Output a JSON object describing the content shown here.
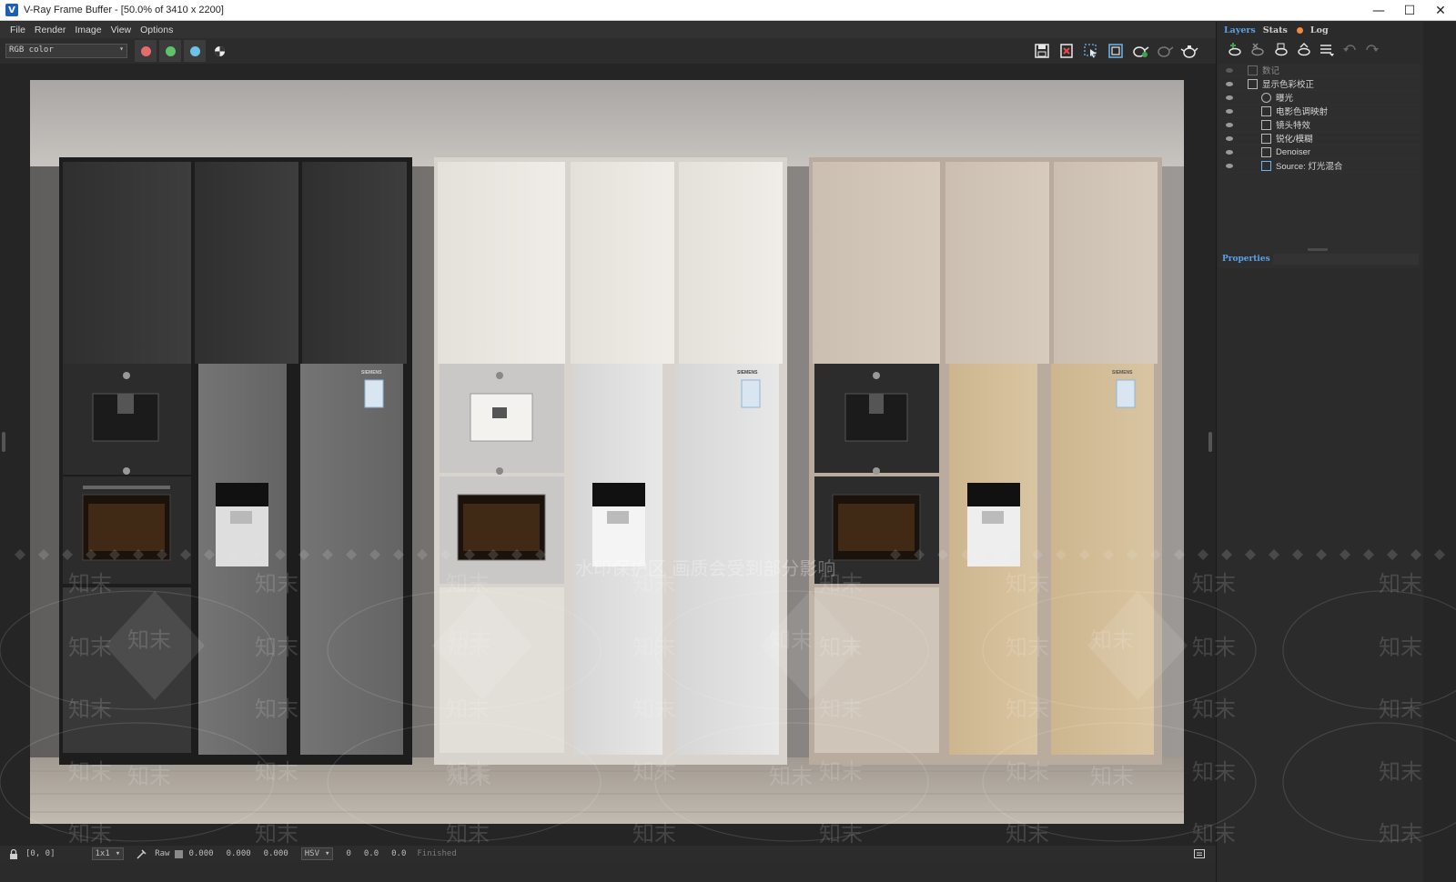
{
  "window": {
    "title": "V-Ray Frame Buffer - [50.0% of 3410 x 2200]",
    "app_icon": "V",
    "controls": {
      "minimize": "—",
      "maximize": "☐",
      "close": "✕"
    }
  },
  "menu": [
    "File",
    "Render",
    "Image",
    "View",
    "Options"
  ],
  "toolbar": {
    "channel": "RGB color",
    "channel_arrow": "▾",
    "color_buttons": [
      {
        "name": "red-channel",
        "color": "#e46c6c"
      },
      {
        "name": "green-channel",
        "color": "#5ec46a"
      },
      {
        "name": "blue-channel",
        "color": "#6cc3e8"
      }
    ],
    "right_icons": [
      "save-image-icon",
      "clear-image-icon",
      "region-render-icon",
      "track-mouse-icon",
      "render-icon",
      "stop-render-icon",
      "render-teapot-icon"
    ]
  },
  "render": {
    "product_brand": "SIEMENS",
    "watermark_banner": "水印保护区  画质会受到部分影响",
    "watermark_tile": "知末"
  },
  "status": {
    "coords": "[0, 0]",
    "zoom": "1x1",
    "zoom_arrow": "▾",
    "mode": "Raw",
    "values": [
      "0.000",
      "0.000",
      "0.000"
    ],
    "color_mode": "HSV",
    "hsv_values": [
      "0",
      "0.0",
      "0.0"
    ],
    "state": "Finished"
  },
  "panel": {
    "tabs": [
      "Layers",
      "Stats",
      "Log"
    ],
    "active_tab": "Layers",
    "layer_tools": [
      "add-layer-icon",
      "delete-layer-icon",
      "save-layer-icon",
      "load-layer-icon",
      "layer-list-icon",
      "undo-icon",
      "redo-icon"
    ],
    "layers": [
      {
        "name": "数记",
        "indent": 1,
        "visible": false
      },
      {
        "name": "显示色彩校正",
        "indent": 1,
        "visible": true
      },
      {
        "name": "曝光",
        "indent": 2,
        "visible": true
      },
      {
        "name": "电影色调映射",
        "indent": 2,
        "visible": true
      },
      {
        "name": "镜头特效",
        "indent": 2,
        "visible": true
      },
      {
        "name": "锐化/模糊",
        "indent": 2,
        "visible": true
      },
      {
        "name": "Denoiser",
        "indent": 2,
        "visible": true
      },
      {
        "name": "Source: 灯光混合",
        "indent": 2,
        "visible": true
      }
    ],
    "properties_label": "Properties"
  }
}
